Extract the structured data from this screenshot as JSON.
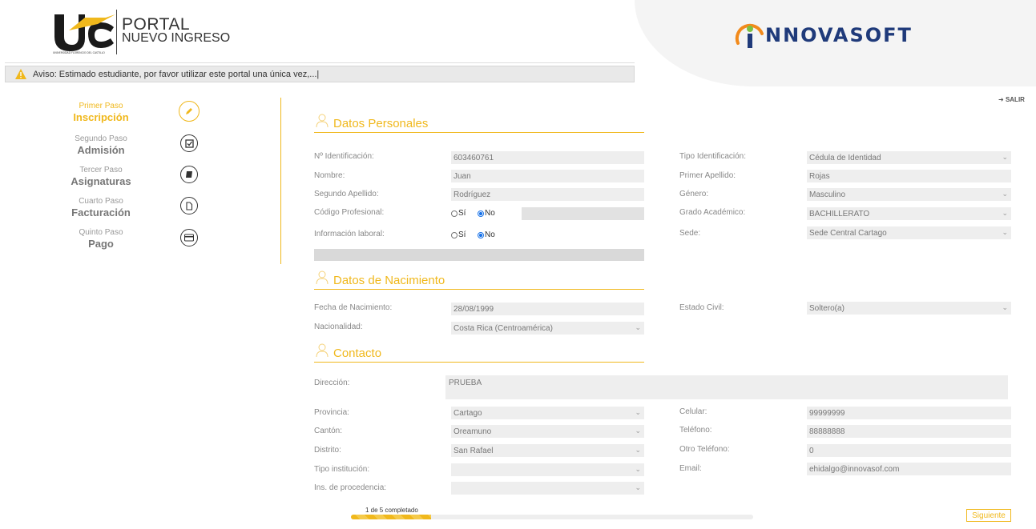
{
  "header": {
    "portal_line1": "PORTAL",
    "portal_line2": "NUEVO INGRESO",
    "brand": "NNOVASOFT",
    "uca_small": "UNIVERSIDAD FLORENCIO DEL CASTILLO"
  },
  "notice": "Aviso: Estimado estudiante, por favor utilizar este portal una única vez,...|",
  "logout_label": "SALIR",
  "steps": [
    {
      "sub": "Primer Paso",
      "main": "Inscripción",
      "icon": "pencil-icon",
      "active": true
    },
    {
      "sub": "Segundo Paso",
      "main": "Admisión",
      "icon": "checkbox-icon",
      "active": false
    },
    {
      "sub": "Tercer Paso",
      "main": "Asignaturas",
      "icon": "book-icon",
      "active": false
    },
    {
      "sub": "Cuarto Paso",
      "main": "Facturación",
      "icon": "document-icon",
      "active": false
    },
    {
      "sub": "Quinto Paso",
      "main": "Pago",
      "icon": "credit-card-icon",
      "active": false
    }
  ],
  "sections": {
    "personal": "Datos Personales",
    "birth": "Datos de Nacimiento",
    "contact": "Contacto"
  },
  "personal": {
    "id_label": "Nº Identificación:",
    "id_value": "603460761",
    "id_type_label": "Tipo Identificación:",
    "id_type_value": "Cédula de Identidad",
    "name_label": "Nombre:",
    "name_value": "Juan",
    "last1_label": "Primer Apellido:",
    "last1_value": "Rojas",
    "last2_label": "Segundo Apellido:",
    "last2_value": "Rodríguez",
    "gender_label": "Género:",
    "gender_value": "Masculino",
    "prof_code_label": "Código Profesional:",
    "academic_label": "Grado Académico:",
    "academic_value": "BACHILLERATO",
    "work_label": "Información laboral:",
    "campus_label": "Sede:",
    "campus_value": "Sede Central Cartago",
    "radio_yes": "Sí",
    "radio_no": "No"
  },
  "birth": {
    "date_label": "Fecha de Nacimiento:",
    "date_value": "28/08/1999",
    "civil_label": "Estado Civil:",
    "civil_value": "Soltero(a)",
    "nationality_label": "Nacionalidad:",
    "nationality_value": "Costa Rica (Centroamérica)"
  },
  "contact": {
    "address_label": "Dirección:",
    "address_value": "PRUEBA",
    "province_label": "Provincia:",
    "province_value": "Cartago",
    "mobile_label": "Celular:",
    "mobile_value": "99999999",
    "canton_label": "Cantón:",
    "canton_value": "Oreamuno",
    "phone_label": "Teléfono:",
    "phone_value": "88888888",
    "district_label": "Distrito:",
    "district_value": "San Rafael",
    "other_phone_label": "Otro Teléfono:",
    "other_phone_value": "0",
    "inst_type_label": "Tipo institución:",
    "inst_type_value": "",
    "email_label": "Email:",
    "email_value": "ehidalgo@innovasof.com",
    "origin_label": "Ins. de procedencia:",
    "origin_value": ""
  },
  "progress": {
    "label": "1 de 5 completado",
    "fraction": 0.2
  },
  "next_label": "Siguiente",
  "colors": {
    "accent": "#f0b81c",
    "brand_blue": "#1f3a7a",
    "brand_orange": "#f28a1b"
  }
}
